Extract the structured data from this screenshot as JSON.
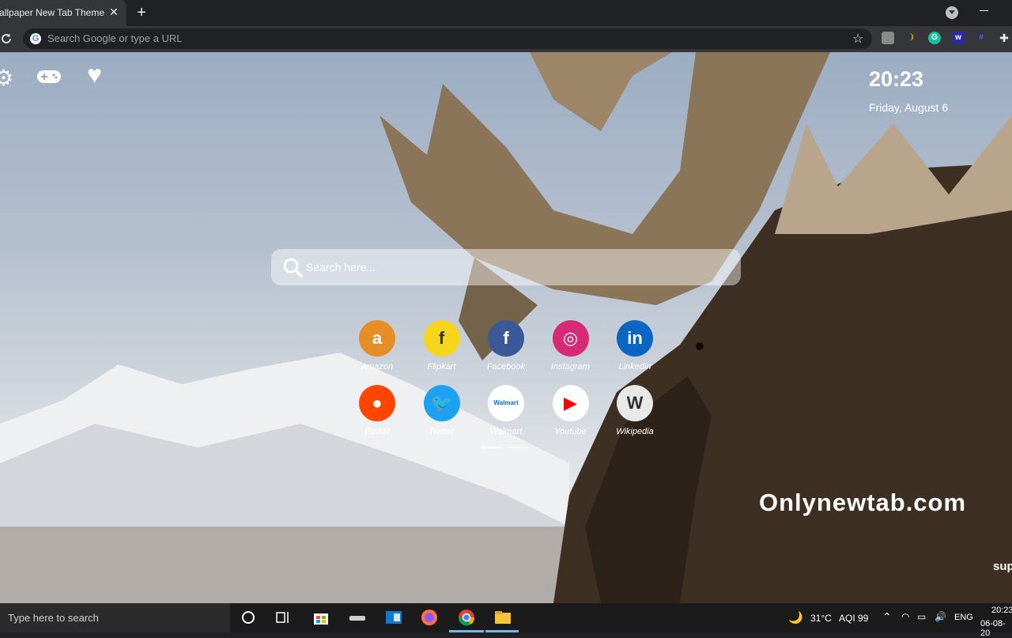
{
  "browser": {
    "tab_title": "Moose Wallpaper New Tab Theme",
    "tab_close": "✕",
    "new_tab": "+",
    "omnibox_placeholder": "Search Google or type a URL",
    "extensions": [
      "metamask-icon",
      "mm-icon",
      "grammarly-icon",
      "w-icon",
      "hashtag-icon",
      "puzzle-icon"
    ]
  },
  "page": {
    "clock": "20:23",
    "date": "Friday, August 6",
    "search_placeholder": "Search here...",
    "watermark": "Onlynewtab.com",
    "corner_text": "sup",
    "shortcuts": [
      {
        "label": "Amazon",
        "color": "#e48e25",
        "glyph": "a"
      },
      {
        "label": "Flipkart",
        "color": "#f7d51d",
        "glyph": "f"
      },
      {
        "label": "Facebook",
        "color": "#3b5998",
        "glyph": "f"
      },
      {
        "label": "Instagram",
        "color": "#d62976",
        "glyph": "◎"
      },
      {
        "label": "Linkedin",
        "color": "#0a66c2",
        "glyph": "in"
      },
      {
        "label": "Reddit",
        "color": "#ff4500",
        "glyph": "●"
      },
      {
        "label": "Twitter",
        "color": "#1da1f2",
        "glyph": "🐦"
      },
      {
        "label": "Walmart",
        "color": "#ffffff",
        "glyph": "Walmart"
      },
      {
        "label": "Youtube",
        "color": "#ffffff",
        "glyph": "▶"
      },
      {
        "label": "Wikipedia",
        "color": "#e8e8e8",
        "glyph": "W"
      }
    ]
  },
  "taskbar": {
    "search_placeholder": "Type here to search",
    "weather": "31°C",
    "aqi": "AQI 99",
    "language": "ENG",
    "time": "20:23",
    "date": "06-08-20"
  }
}
